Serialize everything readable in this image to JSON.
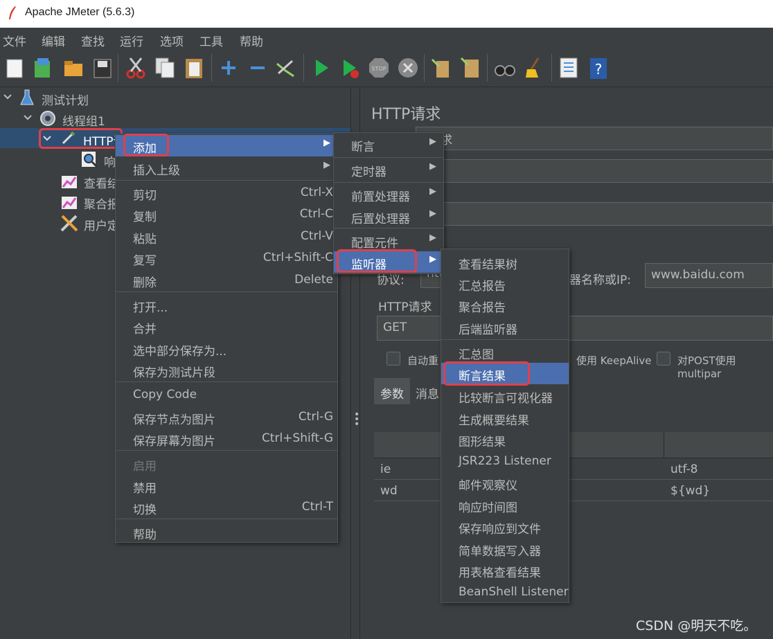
{
  "window": {
    "title": "Apache JMeter (5.6.3)"
  },
  "menubar": [
    "文件",
    "编辑",
    "查找",
    "运行",
    "选项",
    "工具",
    "帮助"
  ],
  "toolbar_icons": [
    "new-icon",
    "templates-icon",
    "open-icon",
    "save-icon",
    "cut-icon",
    "copy-icon",
    "paste-icon",
    "expand-icon",
    "collapse-icon",
    "toggle-icon",
    "start-icon",
    "start-no-pause-icon",
    "stop-icon",
    "shutdown-icon",
    "clear-icon",
    "clear-all-icon",
    "search-icon",
    "reset-search-icon",
    "function-helper-icon",
    "help-icon"
  ],
  "tree": {
    "plan": "测试计划",
    "thread_group": "线程组1",
    "http": "HTTP请",
    "resp": "响",
    "view1": "查看结",
    "agg": "聚合报",
    "user": "用户定"
  },
  "right": {
    "title": "HTTP请求",
    "name_value": "P请求",
    "protocol_label": "协议:",
    "protocol_value": "htt",
    "server_label": "器名称或IP:",
    "server_value": "www.baidu.com",
    "section": "HTTP请求",
    "method": "GET",
    "auto_redirect": "自动重",
    "keepalive": "使用 KeepAlive",
    "multipart": "对POST使用multipar",
    "tab_params": "参数",
    "tab_body": "消息",
    "rows": [
      {
        "name": "ie",
        "value": "utf-8"
      },
      {
        "name": "wd",
        "value": "${wd}"
      }
    ]
  },
  "context_menu": {
    "items": [
      {
        "label": "添加",
        "shortcut": "",
        "arrow": "▶"
      },
      {
        "label": "插入上级",
        "shortcut": "",
        "arrow": "▶"
      },
      {
        "label": "剪切",
        "shortcut": "Ctrl-X"
      },
      {
        "label": "复制",
        "shortcut": "Ctrl-C"
      },
      {
        "label": "粘贴",
        "shortcut": "Ctrl-V"
      },
      {
        "label": "复写",
        "shortcut": "Ctrl+Shift-C"
      },
      {
        "label": "删除",
        "shortcut": "Delete"
      },
      {
        "label": "打开..."
      },
      {
        "label": "合并"
      },
      {
        "label": "选中部分保存为..."
      },
      {
        "label": "保存为测试片段"
      },
      {
        "label": "Copy Code"
      },
      {
        "label": "保存节点为图片",
        "shortcut": "Ctrl-G"
      },
      {
        "label": "保存屏幕为图片",
        "shortcut": "Ctrl+Shift-G"
      },
      {
        "label": "启用"
      },
      {
        "label": "禁用"
      },
      {
        "label": "切换",
        "shortcut": "Ctrl-T"
      },
      {
        "label": "帮助"
      }
    ]
  },
  "add_menu": {
    "items": [
      "断言",
      "定时器",
      "前置处理器",
      "后置处理器",
      "配置元件",
      "监听器"
    ]
  },
  "listener_menu": {
    "items": [
      "查看结果树",
      "汇总报告",
      "聚合报告",
      "后端监听器",
      "汇总图",
      "断言结果",
      "比较断言可视化器",
      "生成概要结果",
      "图形结果",
      "JSR223 Listener",
      "邮件观察仪",
      "响应时间图",
      "保存响应到文件",
      "简单数据写入器",
      "用表格查看结果",
      "BeanShell Listener"
    ]
  },
  "watermark": "CSDN @明天不吃。",
  "colors": {
    "selection": "#4b6eaf",
    "highlight": "#e0404a",
    "background": "#3c3f41"
  }
}
